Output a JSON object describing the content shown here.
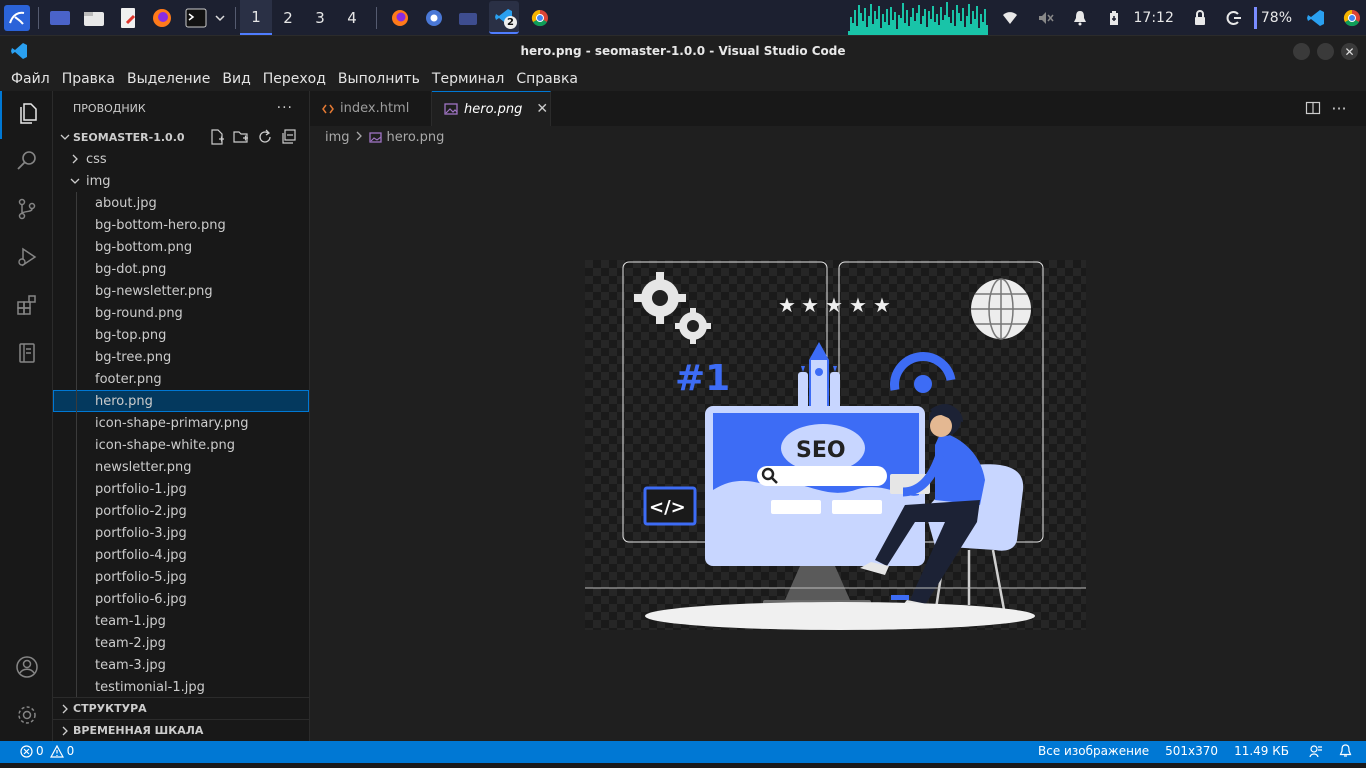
{
  "taskbar": {
    "workspaces": [
      "1",
      "2",
      "3",
      "4"
    ],
    "active_workspace": "1",
    "vscode_badge": "2",
    "clock": "17:12",
    "battery": "78%"
  },
  "window": {
    "title": "hero.png - seomaster-1.0.0 - Visual Studio Code"
  },
  "menu": [
    "Файл",
    "Правка",
    "Выделение",
    "Вид",
    "Переход",
    "Выполнить",
    "Терминал",
    "Справка"
  ],
  "sidebar": {
    "title": "ПРОВОДНИК",
    "root": "SEOMASTER-1.0.0",
    "folders": {
      "css": "css",
      "img": "img"
    },
    "files": [
      "about.jpg",
      "bg-bottom-hero.png",
      "bg-bottom.png",
      "bg-dot.png",
      "bg-newsletter.png",
      "bg-round.png",
      "bg-top.png",
      "bg-tree.png",
      "footer.png",
      "hero.png",
      "icon-shape-primary.png",
      "icon-shape-white.png",
      "newsletter.png",
      "portfolio-1.jpg",
      "portfolio-2.jpg",
      "portfolio-3.jpg",
      "portfolio-4.jpg",
      "portfolio-5.jpg",
      "portfolio-6.jpg",
      "team-1.jpg",
      "team-2.jpg",
      "team-3.jpg",
      "testimonial-1.jpg"
    ],
    "selected_file": "hero.png",
    "outline": "СТРУКТУРА",
    "timeline": "ВРЕМЕННАЯ ШКАЛА"
  },
  "tabs": [
    {
      "label": "index.html",
      "active": false
    },
    {
      "label": "hero.png",
      "active": true
    }
  ],
  "breadcrumb": {
    "folder": "img",
    "file": "hero.png"
  },
  "preview": {
    "seo_text": "SEO",
    "rank_text": "#1",
    "code_text": "</>"
  },
  "status": {
    "errors": "0",
    "warnings": "0",
    "zoom": "Все изображение",
    "dimensions": "501x370",
    "size": "11.49 КБ"
  },
  "colors": {
    "accent": "#0078d4",
    "selection": "#04395e",
    "illustration_blue": "#3d6cf5",
    "illustration_light": "#c8d6ff"
  }
}
